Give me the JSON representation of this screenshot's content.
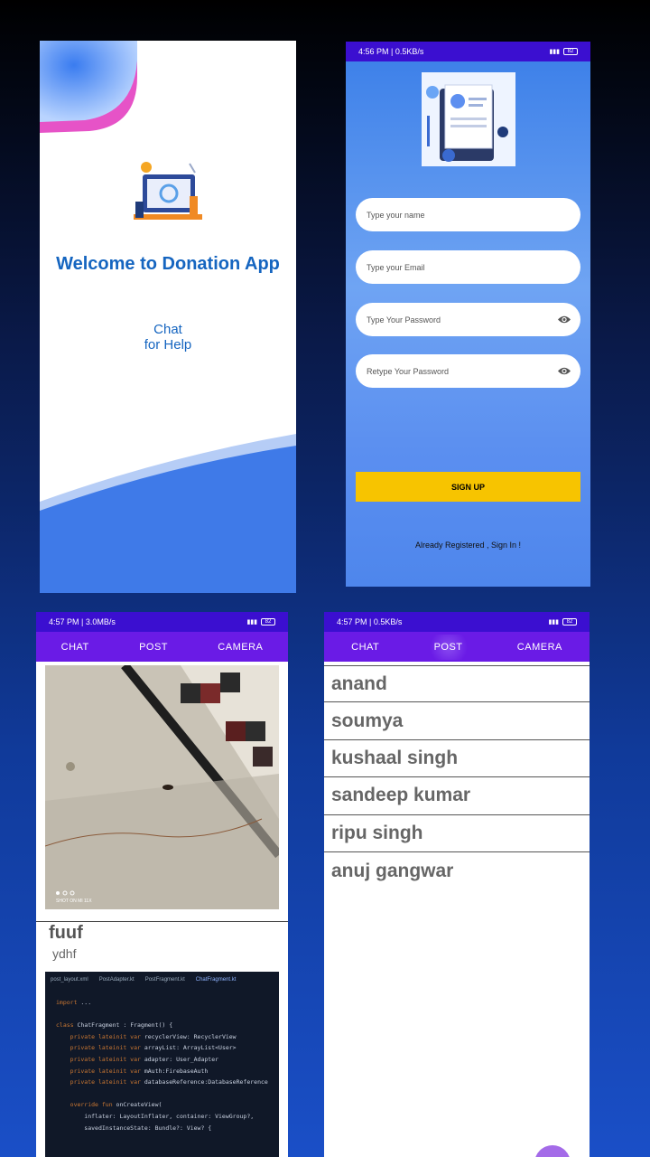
{
  "welcome_screen": {
    "title": "Welcome to Donation App",
    "chat_help": "Chat\nfor Help"
  },
  "signup_screen": {
    "status": {
      "time": "4:56 PM | 0.5KB/s",
      "battery": "82"
    },
    "fields": [
      {
        "placeholder": "Type your name",
        "has_eye": false
      },
      {
        "placeholder": "Type your Email",
        "has_eye": false
      },
      {
        "placeholder": "Type Your Password",
        "has_eye": true
      },
      {
        "placeholder": "Retype Your Password",
        "has_eye": true
      }
    ],
    "signup_label": "SIGN UP",
    "already_label": "Already Registered , Sign In !"
  },
  "post_screen": {
    "status": {
      "time": "4:57 PM | 3.0MB/s",
      "battery": "82"
    },
    "tabs": [
      "CHAT",
      "POST",
      "CAMERA"
    ],
    "active_tab": "POST",
    "post": {
      "title": "fuuf",
      "description": "ydhf",
      "photo_caption": "SHOT ON MI 11X"
    },
    "code_tabs": [
      "post_layout.xml",
      "PostAdapter.kt",
      "PostFragment.kt",
      "ChatFragment.kt"
    ]
  },
  "chat_screen": {
    "status": {
      "time": "4:57 PM | 0.5KB/s",
      "battery": "82"
    },
    "tabs": [
      "CHAT",
      "POST",
      "CAMERA"
    ],
    "active_tab": "POST",
    "users": [
      "anand",
      "soumya",
      "kushaal singh",
      "sandeep kumar",
      "ripu singh",
      "anuj gangwar"
    ]
  },
  "colors": {
    "accent_blue": "#1565c0",
    "tab_purple": "#6a1be6",
    "status_purple": "#3b0fd0",
    "signup_yellow": "#f7c400"
  }
}
